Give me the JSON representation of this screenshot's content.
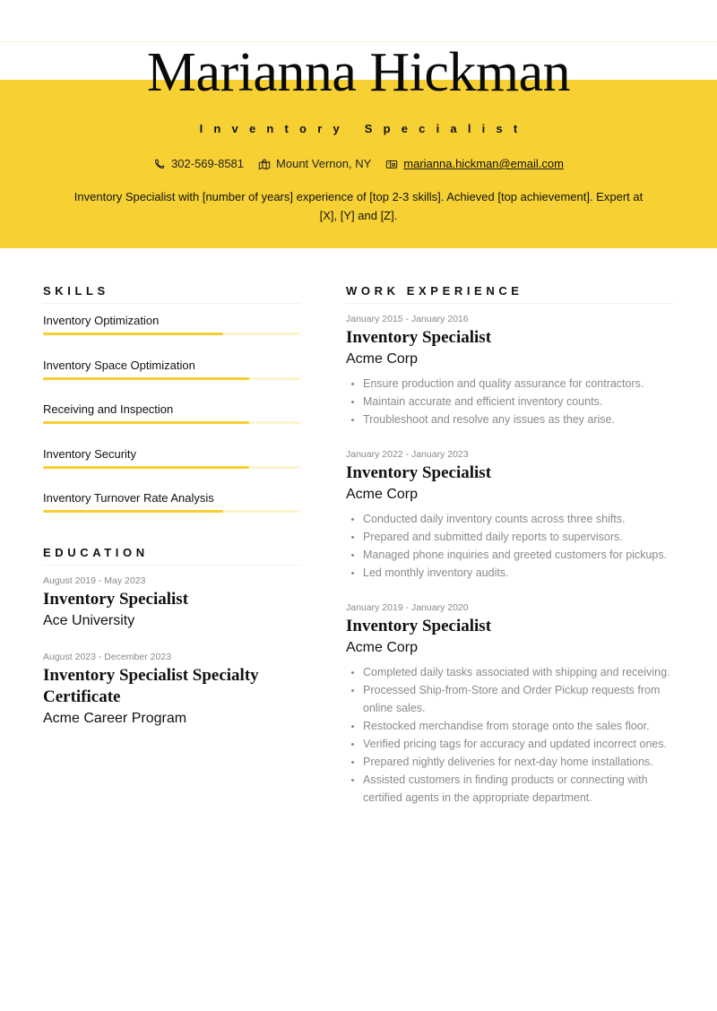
{
  "header": {
    "name": "Marianna Hickman",
    "title": "Inventory Specialist",
    "contacts": [
      {
        "icon": "phone-icon",
        "text": "302-569-8581"
      },
      {
        "icon": "location-icon",
        "text": "Mount Vernon, NY"
      },
      {
        "icon": "email-icon",
        "text": "marianna.hickman@email.com"
      }
    ],
    "summary": "Inventory Specialist with [number of years] experience of [top 2-3 skills]. Achieved [top achievement]. Expert at [X], [Y] and [Z]."
  },
  "colors": {
    "accent": "#f7d134",
    "bar_track": "#fdf4cd",
    "muted_text": "#8a8a8a"
  },
  "skills": {
    "heading": "SKILLS",
    "items": [
      {
        "name": "Inventory Optimization",
        "level": 0.7
      },
      {
        "name": "Inventory Space Optimization",
        "level": 0.8
      },
      {
        "name": "Receiving and Inspection",
        "level": 0.8
      },
      {
        "name": "Inventory Security",
        "level": 0.8
      },
      {
        "name": "Inventory Turnover Rate Analysis",
        "level": 0.7
      }
    ]
  },
  "education": {
    "heading": "EDUCATION",
    "items": [
      {
        "dates": "August 2019 - May 2023",
        "degree": "Inventory Specialist",
        "school": "Ace University"
      },
      {
        "dates": "August 2023 - December 2023",
        "degree": "Inventory Specialist Specialty Certificate",
        "school": "Acme Career Program"
      }
    ]
  },
  "experience": {
    "heading": "WORK EXPERIENCE",
    "items": [
      {
        "dates": "January 2015 - January 2016",
        "role": "Inventory Specialist",
        "company": "Acme Corp",
        "bullets": [
          "Ensure production and quality assurance for contractors.",
          "Maintain accurate and efficient inventory counts.",
          "Troubleshoot and resolve any issues as they arise."
        ]
      },
      {
        "dates": "January 2022 - January 2023",
        "role": "Inventory Specialist",
        "company": "Acme Corp",
        "bullets": [
          "Conducted daily inventory counts across three shifts.",
          "Prepared and submitted daily reports to supervisors.",
          "Managed phone inquiries and greeted customers for pickups.",
          "Led monthly inventory audits."
        ]
      },
      {
        "dates": "January 2019 - January 2020",
        "role": "Inventory Specialist",
        "company": "Acme Corp",
        "bullets": [
          "Completed daily tasks associated with shipping and receiving.",
          "Processed Ship-from-Store and Order Pickup requests from online sales.",
          "Restocked merchandise from storage onto the sales floor.",
          "Verified pricing tags for accuracy and updated incorrect ones.",
          "Prepared nightly deliveries for next-day home installations.",
          "Assisted customers in finding products or connecting with certified agents in the appropriate department."
        ]
      }
    ]
  }
}
